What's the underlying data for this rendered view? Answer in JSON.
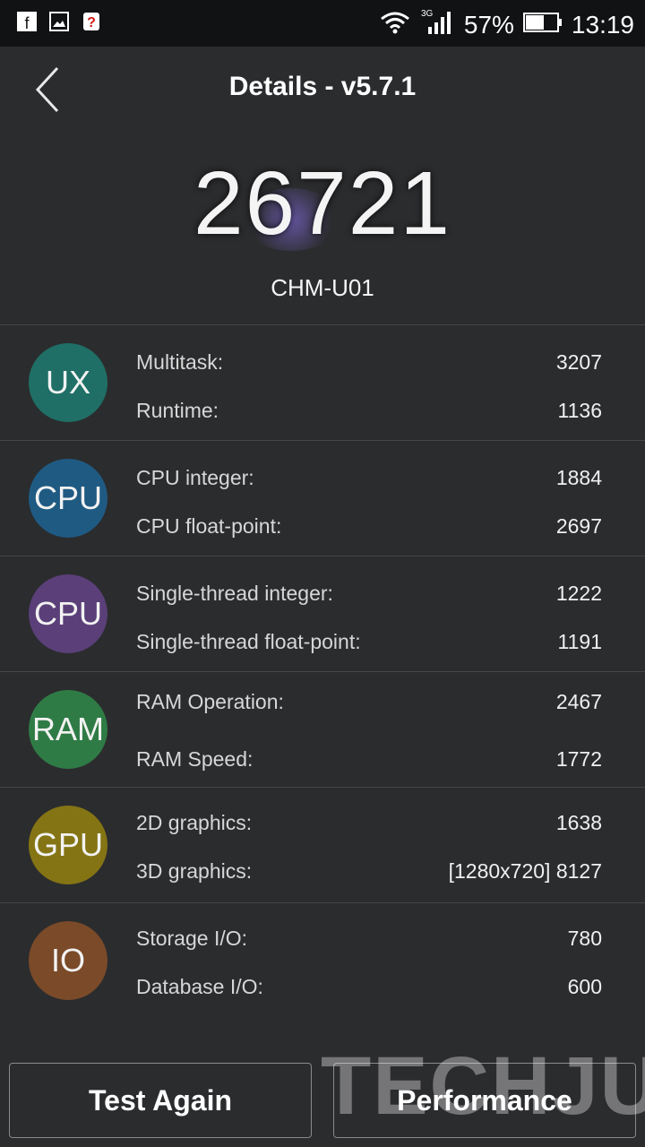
{
  "status_bar": {
    "icons": [
      "facebook-icon",
      "image-icon",
      "app-icon"
    ],
    "battery": "57%",
    "time": "13:19",
    "network": "3G"
  },
  "header": {
    "title": "Details - v5.7.1",
    "back_icon": "back-arrow-icon"
  },
  "summary": {
    "score": "26721",
    "device": "CHM-U01"
  },
  "categories": [
    {
      "badge": "UX",
      "color": "#1f6f66",
      "items": [
        {
          "label": "Multitask:",
          "value": "3207"
        },
        {
          "label": "Runtime:",
          "value": "1136"
        }
      ]
    },
    {
      "badge": "CPU",
      "color": "#1f5a83",
      "items": [
        {
          "label": "CPU integer:",
          "value": "1884"
        },
        {
          "label": "CPU float-point:",
          "value": "2697"
        }
      ]
    },
    {
      "badge": "CPU",
      "color": "#5a3f78",
      "items": [
        {
          "label": "Single-thread integer:",
          "value": "1222"
        },
        {
          "label": "Single-thread float-point:",
          "value": "1191"
        }
      ]
    },
    {
      "badge": "RAM",
      "color": "#2f7b45",
      "items": [
        {
          "label": "RAM Operation:",
          "value": "2467"
        },
        {
          "label": "RAM Speed:",
          "value": "1772"
        }
      ]
    },
    {
      "badge": "GPU",
      "color": "#847414",
      "items": [
        {
          "label": "2D graphics:",
          "value": "1638"
        },
        {
          "label": "3D graphics:",
          "value": "[1280x720] 8127"
        }
      ]
    },
    {
      "badge": "IO",
      "color": "#7a4a29",
      "items": [
        {
          "label": "Storage I/O:",
          "value": "780"
        },
        {
          "label": "Database I/O:",
          "value": "600"
        }
      ]
    }
  ],
  "footer": {
    "test_again": "Test Again",
    "performance": "Performance"
  },
  "watermark": "TECHJUICE"
}
